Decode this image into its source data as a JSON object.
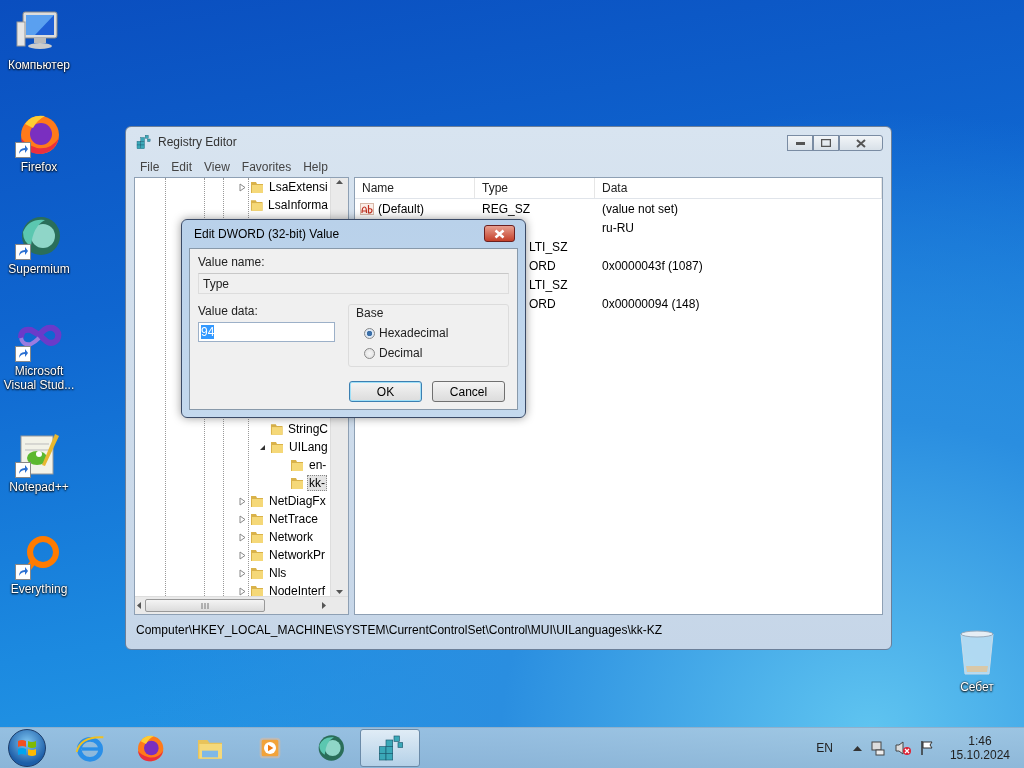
{
  "desktop_icons": [
    {
      "label": "Компьютер",
      "kind": "computer",
      "shortcut": false
    },
    {
      "label": "Firefox",
      "kind": "firefox",
      "shortcut": true
    },
    {
      "label": "Supermium",
      "kind": "supermium",
      "shortcut": true
    },
    {
      "label": "Microsoft Visual Stud...",
      "kind": "vs",
      "shortcut": true
    },
    {
      "label": "Notepad++",
      "kind": "notepad",
      "shortcut": true
    },
    {
      "label": "Everything",
      "kind": "everything",
      "shortcut": true
    }
  ],
  "recycle_bin": {
    "label": "Себет"
  },
  "registry_window": {
    "title": "Registry Editor",
    "menu": [
      "File",
      "Edit",
      "View",
      "Favorites",
      "Help"
    ],
    "tree": {
      "upper": [
        {
          "label": "LsaExtensi",
          "expanded": false
        },
        {
          "label": "LsaInforma"
        }
      ],
      "nested": [
        {
          "label": "StringC"
        },
        {
          "label": "UILang",
          "expanded": true,
          "children": [
            {
              "label": "en-",
              "selected": false
            },
            {
              "label": "kk-",
              "selected": true
            }
          ]
        }
      ],
      "lower": [
        {
          "label": "NetDiagFx",
          "expanded": false
        },
        {
          "label": "NetTrace",
          "expanded": false
        },
        {
          "label": "Network",
          "expanded": false
        },
        {
          "label": "NetworkPr",
          "expanded": false
        },
        {
          "label": "Nls",
          "expanded": false
        },
        {
          "label": "NodeInterf",
          "expanded": false
        }
      ]
    },
    "columns": [
      "Name",
      "Type",
      "Data"
    ],
    "rows": [
      {
        "name": "(Default)",
        "type": "REG_SZ",
        "data": "(value not set)"
      },
      {
        "data": "ru-RU"
      },
      {
        "type": "LTI_SZ",
        "type_cut": true
      },
      {
        "type": "ORD",
        "type_cut": true,
        "data": "0x0000043f (1087)"
      },
      {
        "type": "LTI_SZ",
        "type_cut": true
      },
      {
        "type": "ORD",
        "type_cut": true,
        "data": "0x00000094 (148)"
      }
    ],
    "status_bar": "Computer\\HKEY_LOCAL_MACHINE\\SYSTEM\\CurrentControlSet\\Control\\MUI\\UILanguages\\kk-KZ"
  },
  "dialog": {
    "title": "Edit DWORD (32-bit) Value",
    "value_name_label": "Value name:",
    "value_name": "Type",
    "value_data_label": "Value data:",
    "value_data": "94",
    "value_data_highlighted": true,
    "base": {
      "label": "Base",
      "options": [
        {
          "label": "Hexadecimal",
          "selected": true
        },
        {
          "label": "Decimal",
          "selected": false
        }
      ]
    },
    "buttons": [
      {
        "label": "OK",
        "default": true
      },
      {
        "label": "Cancel",
        "default": false
      }
    ]
  },
  "taskbar": {
    "apps": [
      {
        "kind": "ie",
        "active": false
      },
      {
        "kind": "firefox",
        "active": false
      },
      {
        "kind": "explorer",
        "active": false
      },
      {
        "kind": "media",
        "active": false
      },
      {
        "kind": "supermium",
        "active": false
      },
      {
        "kind": "regedit",
        "active": true
      }
    ],
    "language": "EN",
    "volume_muted": true,
    "time": "1:46",
    "date": "15.10.2024"
  }
}
